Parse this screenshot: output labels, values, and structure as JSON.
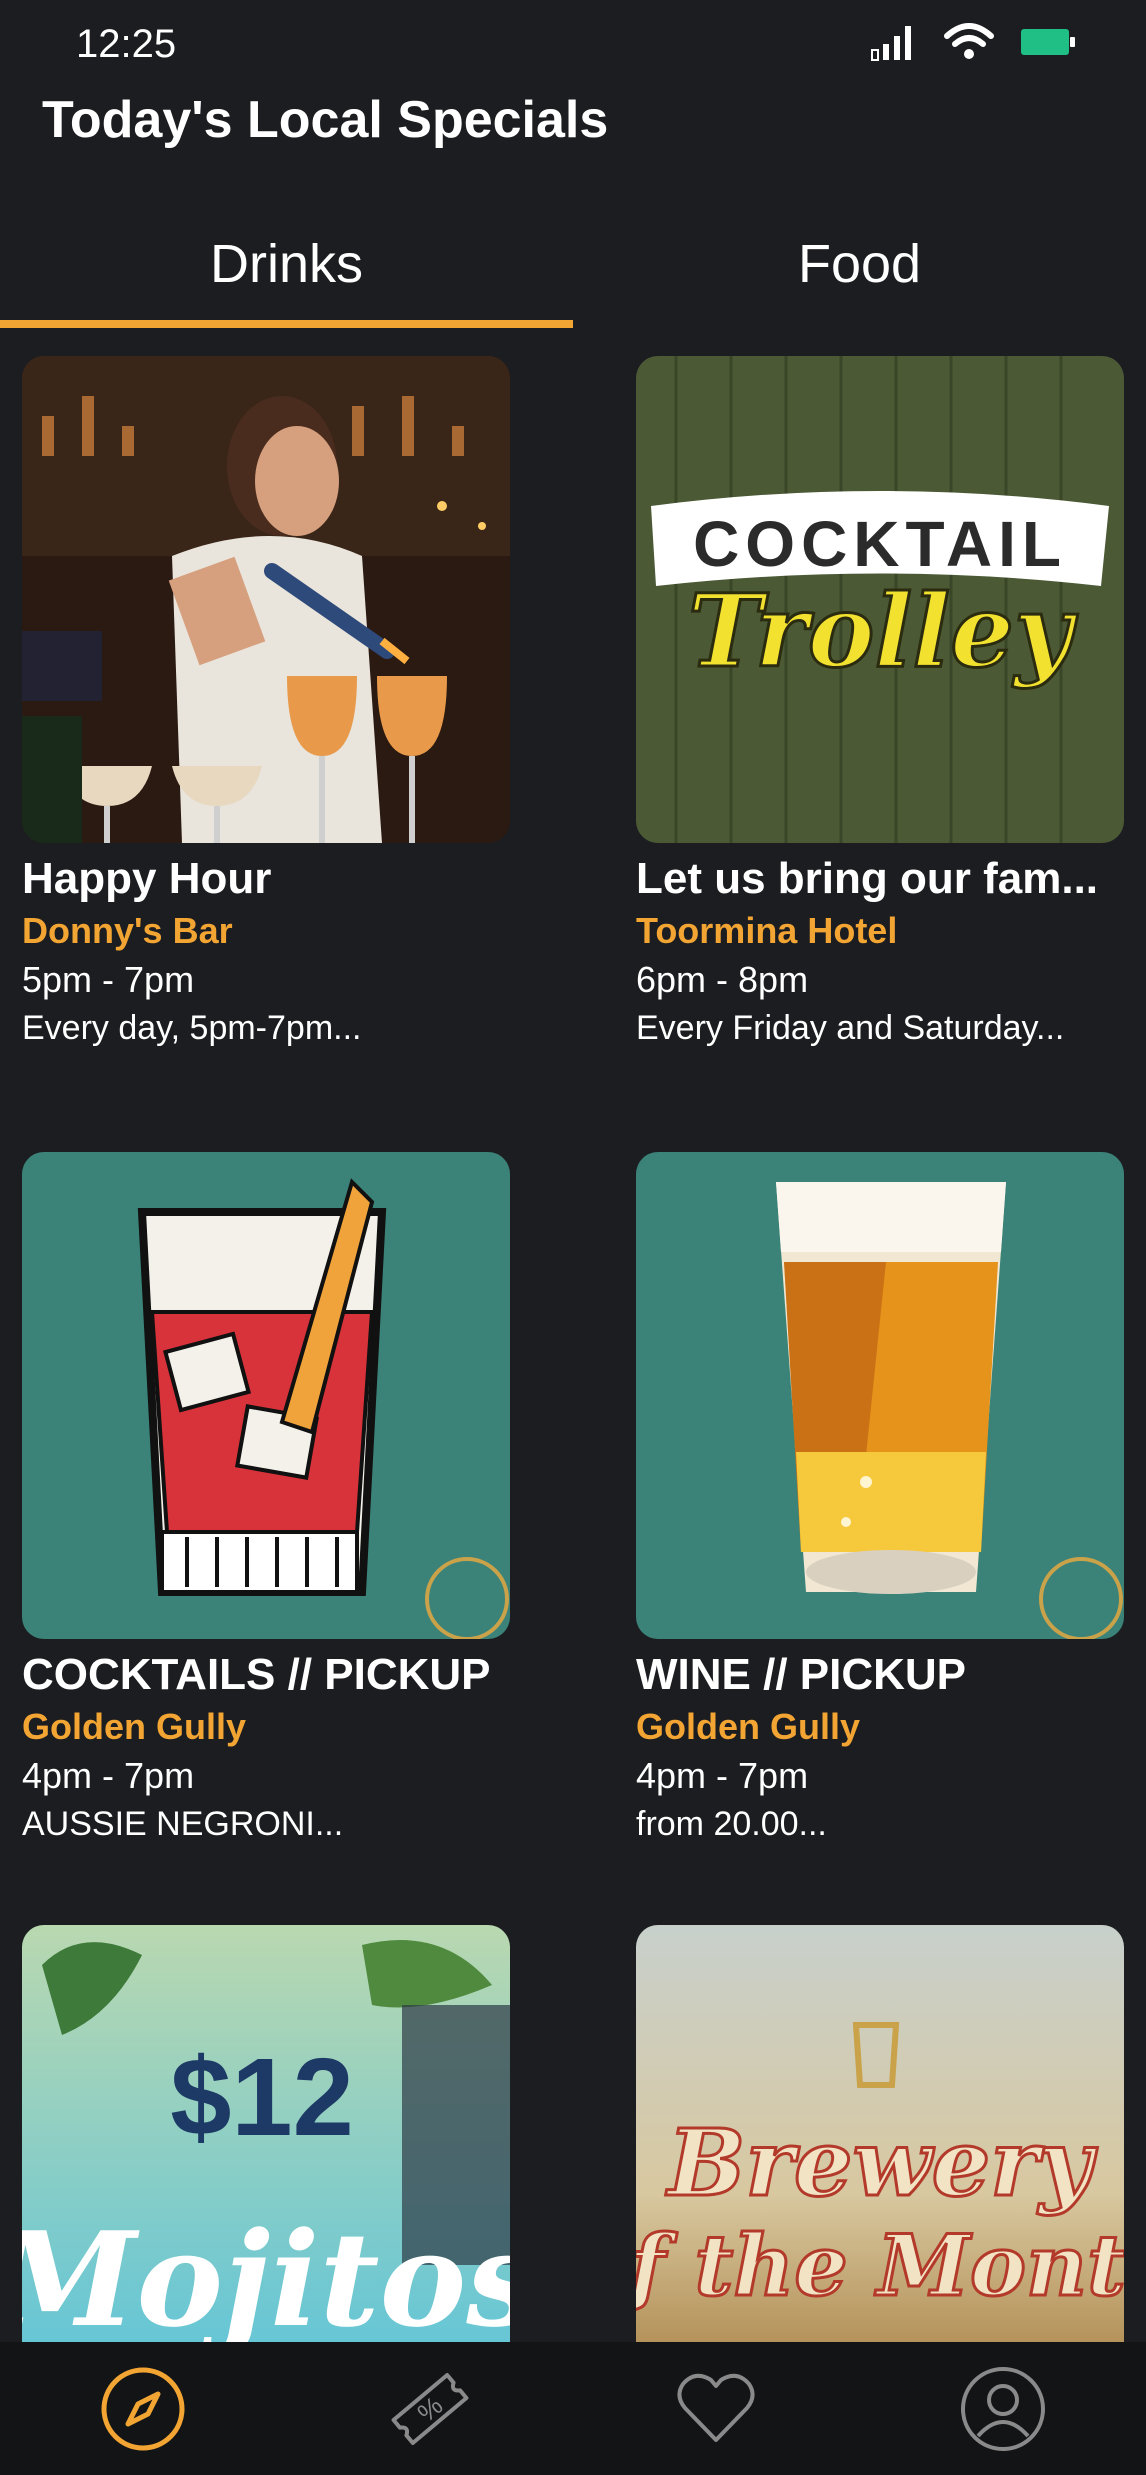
{
  "status": {
    "time": "12:25"
  },
  "header": {
    "title": "Today's Local Specials"
  },
  "tabs": [
    {
      "label": "Drinks",
      "active": true
    },
    {
      "label": "Food",
      "active": false
    }
  ],
  "cards": [
    {
      "title": "Happy Hour",
      "venue": "Donny's Bar",
      "time": "5pm - 7pm",
      "desc": "Every day, 5pm-7pm..."
    },
    {
      "title": "Let us bring our fam...",
      "venue": "Toormina Hotel",
      "time": "6pm - 8pm",
      "desc": "Every Friday and Saturday...",
      "image_text": [
        "COCKTAIL",
        "Trolley"
      ]
    },
    {
      "title": "COCKTAILS // PICKUP",
      "venue": "Golden Gully",
      "time": "4pm - 7pm",
      "desc": "AUSSIE NEGRONI..."
    },
    {
      "title": "WINE // PICKUP",
      "venue": "Golden Gully",
      "time": "4pm - 7pm",
      "desc": "from 20.00..."
    },
    {
      "title": "",
      "venue": "",
      "time": "",
      "desc": "",
      "image_text": [
        "$12",
        "Mojitos"
      ]
    },
    {
      "title": "",
      "venue": "",
      "time": "",
      "desc": "",
      "image_text": [
        "Brewery",
        "of the Month"
      ]
    }
  ],
  "colors": {
    "accent": "#f3a533",
    "background": "#1c1d20",
    "nav_background": "#131416",
    "battery": "#1fbf86"
  },
  "bottom_nav": [
    {
      "icon": "compass-icon",
      "active": true
    },
    {
      "icon": "coupon-icon",
      "active": false
    },
    {
      "icon": "heart-icon",
      "active": false
    },
    {
      "icon": "profile-icon",
      "active": false
    }
  ]
}
